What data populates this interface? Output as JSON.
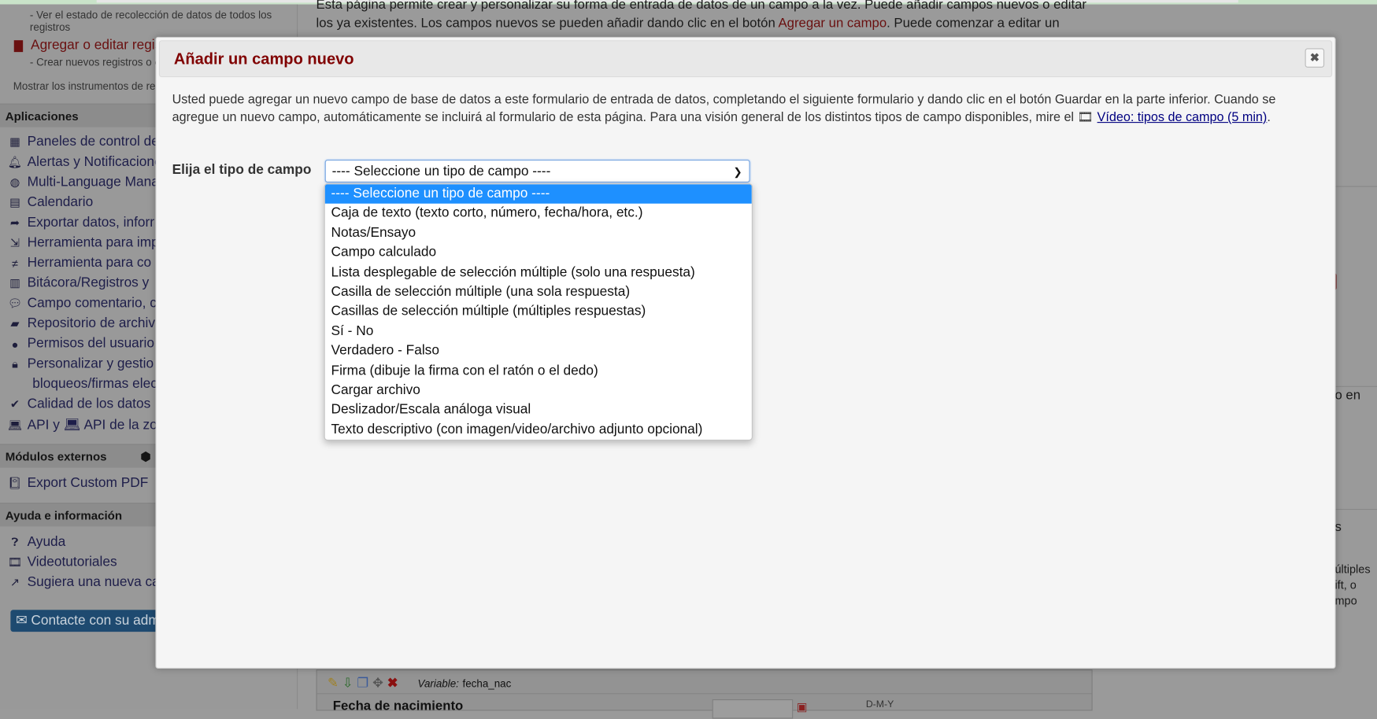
{
  "sidebar": {
    "status_sub": "- Ver el estado de recolección de datos de todos los registros",
    "add_edit": "Agregar o editar regis",
    "add_edit_sub": "- Crear nuevos registros o e",
    "show_instruments": "Mostrar los instrumentos de re",
    "apps_header": "Aplicaciones",
    "apps": [
      {
        "icon": "dashboard-icon",
        "glyph": "▦",
        "label": "Paneles de control de"
      },
      {
        "icon": "bell-icon",
        "glyph": "🔔︎",
        "label": "Alertas y Notificacione"
      },
      {
        "icon": "globe-icon",
        "glyph": "◍",
        "label": "Multi-Language Mana"
      },
      {
        "icon": "calendar-icon",
        "glyph": "▤",
        "label": "Calendario"
      },
      {
        "icon": "export-icon",
        "glyph": "➦",
        "label": "Exportar datos, inforr"
      },
      {
        "icon": "import-icon",
        "glyph": "⇲",
        "label": "Herramienta para imp"
      },
      {
        "icon": "not-equal-icon",
        "glyph": "≠",
        "label": "Herramienta para co"
      },
      {
        "icon": "log-icon",
        "glyph": "▥",
        "label": "Bitácora/Registros   y"
      },
      {
        "icon": "comments-icon",
        "glyph": "💬︎",
        "label": "Campo comentario, c"
      },
      {
        "icon": "folder-icon",
        "glyph": "▰",
        "label": "Repositorio de archiv"
      },
      {
        "icon": "user-icon",
        "glyph": "●",
        "label": "Permisos del usuario"
      },
      {
        "icon": "lock-icon",
        "glyph": "🔒︎",
        "label": "Personalizar y gestio"
      },
      {
        "icon": "",
        "glyph": "",
        "label": "bloqueos/firmas elec"
      },
      {
        "icon": "clipboard-check-icon",
        "glyph": "✔",
        "label": "Calidad de los datos"
      },
      {
        "icon": "laptop-code-icon",
        "glyph": "💻︎",
        "label": "API   y   💻︎ API de la zo"
      }
    ],
    "modules_header": "Módulos externos",
    "modules": [
      {
        "icon": "pdf-book-icon",
        "glyph": "📔︎",
        "label": "Export Custom PDF"
      }
    ],
    "help_header": "Ayuda e información",
    "help": [
      {
        "icon": "question-circle-icon",
        "glyph": "❓︎",
        "label": "Ayuda"
      },
      {
        "icon": "film-icon",
        "glyph": "🎞︎",
        "label": "Videotutoriales"
      },
      {
        "icon": "share-icon",
        "glyph": "↗",
        "label": "Sugiera una nueva ca"
      }
    ],
    "contact_label": "Contacte con su adm"
  },
  "main": {
    "intro_line1": "Esta página permite crear y personalizar su forma de entrada de datos de un campo a la vez. Puede añadir campos nuevos o editar",
    "intro_line2_a": "los ya existentes. Los campos nuevos se pueden añadir dando clic en el botón ",
    "intro_link": "Agregar un campo",
    "intro_line2_b": ". Puede comenzar a editar un",
    "right_frag1": "o en",
    "right_frag2": "s",
    "right_frag3": "últiples",
    "right_frag4": "ift, o",
    "right_frag5": "mpo",
    "variable_label": "Variable:",
    "variable_value": "fecha_nac",
    "field_label": "Fecha de nacimiento",
    "date_format": "D-M-Y"
  },
  "modal": {
    "title": "Añadir un campo nuevo",
    "close_icon": "close-icon",
    "desc": "Usted puede agregar un nuevo campo de base de datos a este formulario de entrada de datos, completando el siguiente formulario y dando clic en el botón Guardar en la parte inferior. Cuando se agregue un nuevo campo, automáticamente se incluirá al formulario de esta página. Para una visión general de los distintos tipos de campo disponibles, mire el ",
    "video_link": "Vídeo: tipos de campo (5 min)",
    "desc_end": ".",
    "field_type_label": "Elija el tipo de campo",
    "select_value": "---- Seleccione un tipo de campo ----",
    "options": [
      "---- Seleccione un tipo de campo ----",
      "Caja de texto (texto corto, número, fecha/hora, etc.)",
      "Notas/Ensayo",
      "Campo calculado",
      "Lista desplegable de selección múltiple (solo una respuesta)",
      "Casilla de selección múltiple (una sola respuesta)",
      "Casillas de selección múltiple (múltiples respuestas)",
      "Sí - No",
      "Verdadero - Falso",
      "Firma (dibuje la firma con el ratón o el dedo)",
      "Cargar archivo",
      "Deslizador/Escala análoga visual",
      "Texto descriptivo (con imagen/video/archivo adjunto opcional)"
    ],
    "selected_index": 0,
    "colors": {
      "title": "#800000",
      "highlight": "#1e90ff",
      "link": "#000080"
    }
  }
}
